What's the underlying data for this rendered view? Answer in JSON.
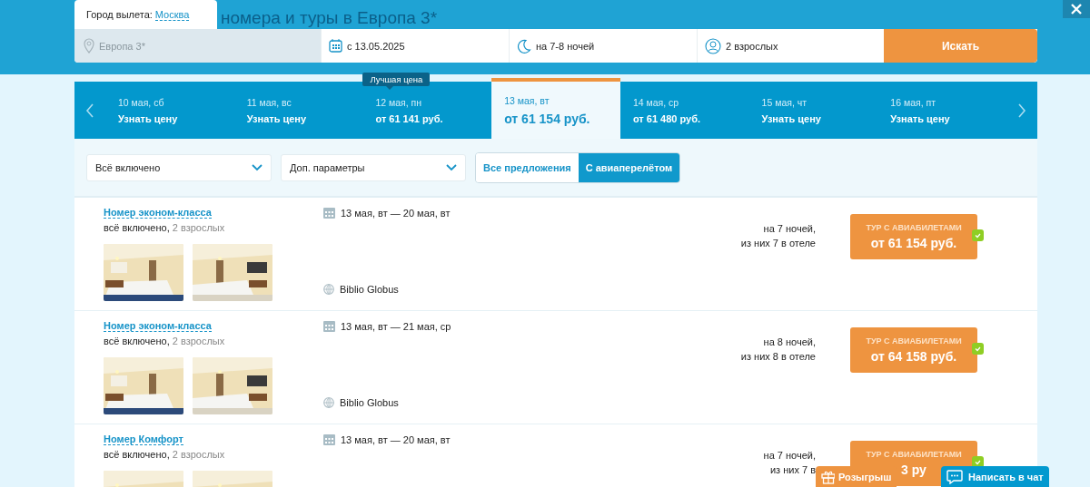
{
  "header": {
    "title": "номера и туры в Европа 3*",
    "departure_label": "Город вылета:",
    "departure_city": "Москва"
  },
  "search": {
    "destination": "Европа 3*",
    "date": "с 13.05.2025",
    "nights": "на 7-8 ночей",
    "guests": "2 взрослых",
    "button": "Искать"
  },
  "date_strip": {
    "best_price_label": "Лучшая цена",
    "days": [
      {
        "date": "10 мая, сб",
        "price": "Узнать цену",
        "selected": false,
        "best": false
      },
      {
        "date": "11 мая, вс",
        "price": "Узнать цену",
        "selected": false,
        "best": false
      },
      {
        "date": "12 мая, пн",
        "price": "от 61 141 руб.",
        "selected": false,
        "best": true
      },
      {
        "date": "13 мая, вт",
        "price": "от 61 154 руб.",
        "selected": true,
        "best": false
      },
      {
        "date": "14 мая, ср",
        "price": "от 61 480 руб.",
        "selected": false,
        "best": false
      },
      {
        "date": "15 мая, чт",
        "price": "Узнать цену",
        "selected": false,
        "best": false
      },
      {
        "date": "16 мая, пт",
        "price": "Узнать цену",
        "selected": false,
        "best": false
      }
    ]
  },
  "filters": {
    "meal": "Всё включено",
    "params": "Доп. параметры",
    "toggle": [
      {
        "label": "Все предложения",
        "selected": false
      },
      {
        "label": "С авиаперелётом",
        "selected": true
      }
    ]
  },
  "offers": [
    {
      "room": "Номер эконом-класса",
      "meal": "всё включено,",
      "guests": "2 взрослых",
      "dates": "13 мая, вт — 20 мая, вт",
      "operator": "Biblio Globus",
      "nights": "на 7 ночей,",
      "hotel_nights": "из них 7 в отеле",
      "button_label": "ТУР С АВИАБИЛЕТАМИ",
      "price": "от 61 154 руб.",
      "checked": true
    },
    {
      "room": "Номер эконом-класса",
      "meal": "всё включено,",
      "guests": "2 взрослых",
      "dates": "13 мая, вт — 21 мая, ср",
      "operator": "Biblio Globus",
      "nights": "на 8 ночей,",
      "hotel_nights": "из них 8 в отеле",
      "button_label": "ТУР С АВИАБИЛЕТАМИ",
      "price": "от 64 158 руб.",
      "checked": true
    },
    {
      "room": "Номер Комфорт",
      "meal": "всё включено,",
      "guests": "2 взрослых",
      "dates": "13 мая, вт — 20 мая, вт",
      "nights": "на 7 ночей,",
      "hotel_nights": "из них 7 в",
      "button_label": "ТУР С АВИАБИЛЕТАМИ",
      "price": "3 ру",
      "checked": true
    }
  ],
  "floating": {
    "raffle": "Розыгрыш",
    "chat": "Написать в чат"
  }
}
